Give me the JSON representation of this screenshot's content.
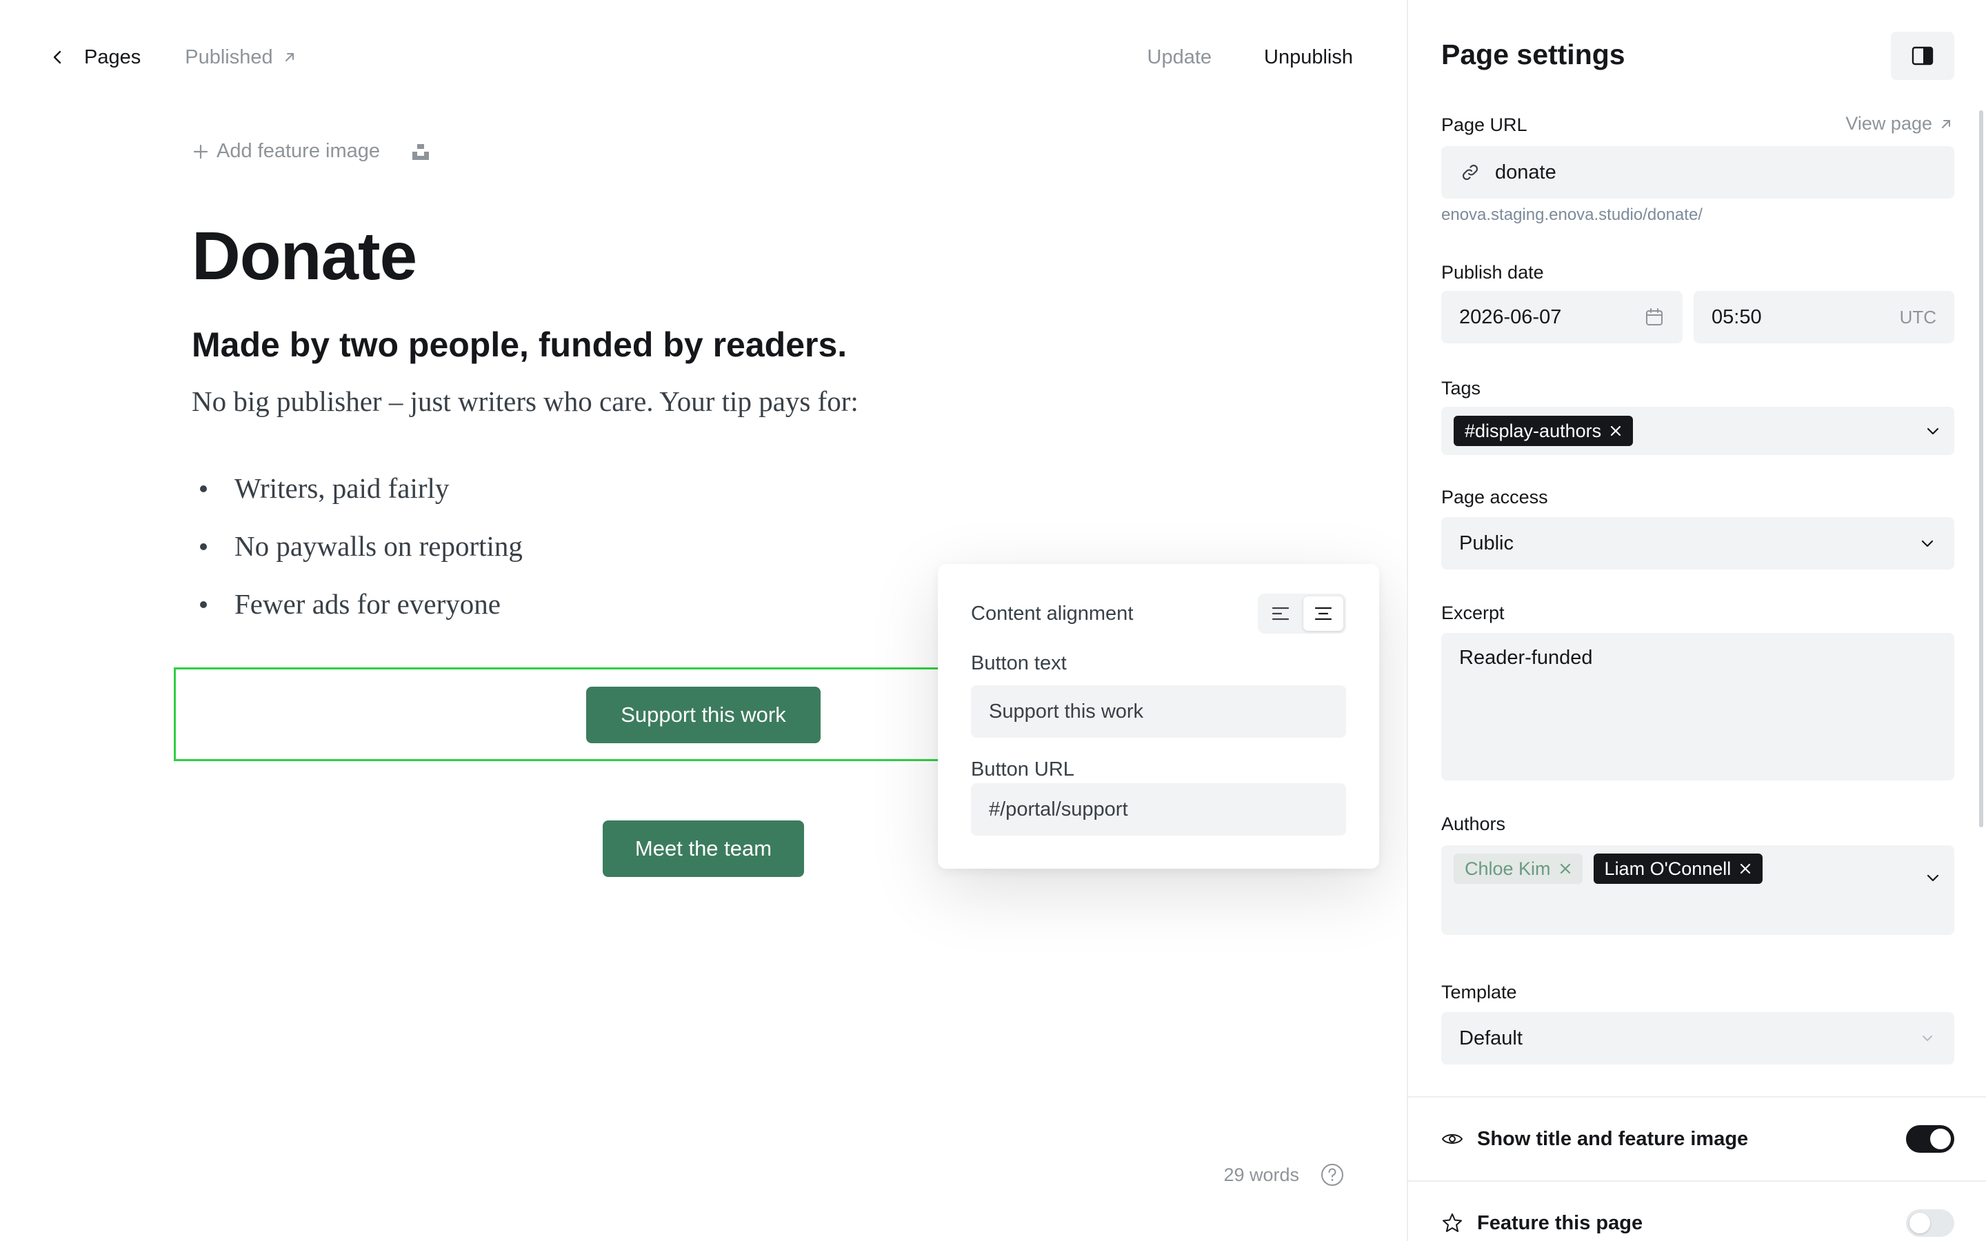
{
  "editor": {
    "back_label": "Pages",
    "status_label": "Published",
    "update_label": "Update",
    "unpublish_label": "Unpublish",
    "add_feature_label": "Add feature image",
    "title": "Donate",
    "heading": "Made by two people, funded by readers.",
    "intro": "No big publisher – just writers who care. Your tip pays for:",
    "bullets": [
      "Writers, paid fairly",
      "No paywalls on reporting",
      "Fewer ads for everyone"
    ],
    "button_primary": "Support this work",
    "button_secondary": "Meet the team",
    "word_count": "29 words"
  },
  "popover": {
    "alignment_label": "Content alignment",
    "alignment_selected": "center",
    "button_text_label": "Button text",
    "button_text_value": "Support this work",
    "button_url_label": "Button URL",
    "button_url_value": "#/portal/support"
  },
  "settings": {
    "title": "Page settings",
    "page_url_label": "Page URL",
    "view_page_label": "View page",
    "slug": "donate",
    "url_hint": "enova.staging.enova.studio/donate/",
    "publish_date_label": "Publish date",
    "date": "2026-06-07",
    "time": "05:50",
    "timezone": "UTC",
    "tags_label": "Tags",
    "tags": [
      "#display-authors"
    ],
    "access_label": "Page access",
    "access_value": "Public",
    "excerpt_label": "Excerpt",
    "excerpt_value": "Reader-funded",
    "authors_label": "Authors",
    "authors": [
      "Chloe Kim",
      "Liam O'Connell"
    ],
    "template_label": "Template",
    "template_value": "Default",
    "show_title_label": "Show title and feature image",
    "show_title_on": true,
    "feature_label": "Feature this page",
    "feature_on": false
  },
  "colors": {
    "accent_green": "#3c7c5e",
    "selection_outline": "#30cf43",
    "field_bg": "#f2f3f4",
    "chip_dark": "#15171a"
  }
}
